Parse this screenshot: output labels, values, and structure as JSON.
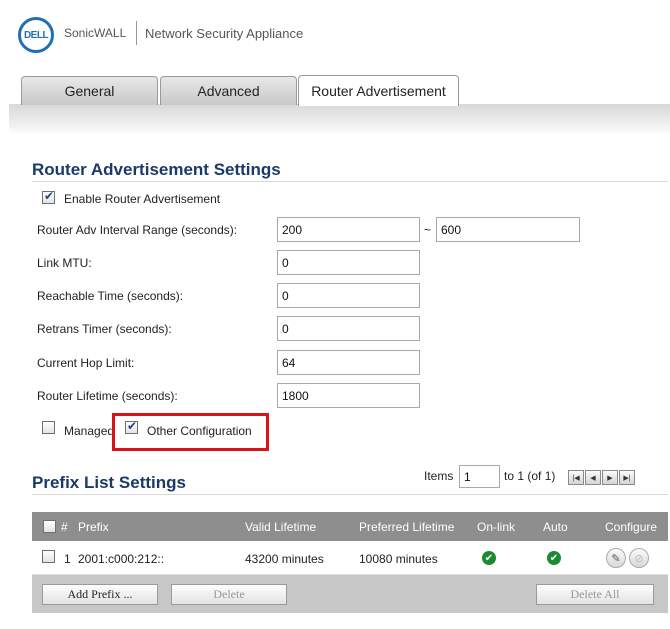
{
  "header": {
    "logo_text": "DELL",
    "brand": "SonicWALL",
    "product": "Network Security Appliance"
  },
  "tabs": [
    {
      "label": "General",
      "active": false
    },
    {
      "label": "Advanced",
      "active": false
    },
    {
      "label": "Router Advertisement",
      "active": true
    }
  ],
  "ra_settings": {
    "title": "Router Advertisement Settings",
    "enable_label": "Enable Router Advertisement",
    "enable_checked": true,
    "interval_label": "Router Adv Interval Range (seconds):",
    "interval_min": "200",
    "interval_sep": "~",
    "interval_max": "600",
    "link_mtu_label": "Link MTU:",
    "link_mtu": "0",
    "reachable_label": "Reachable Time (seconds):",
    "reachable": "0",
    "retrans_label": "Retrans Timer (seconds):",
    "retrans": "0",
    "hop_label": "Current Hop Limit:",
    "hop": "64",
    "lifetime_label": "Router Lifetime (seconds):",
    "lifetime": "1800",
    "managed_label": "Managed",
    "managed_checked": false,
    "other_config_label": "Other Configuration",
    "other_config_checked": true
  },
  "prefix": {
    "title": "Prefix List Settings",
    "items_label": "Items",
    "items_value": "1",
    "items_range": "to 1 (of 1)",
    "columns": {
      "num": "#",
      "prefix": "Prefix",
      "valid": "Valid Lifetime",
      "preferred": "Preferred Lifetime",
      "onlink": "On-link",
      "auto": "Auto",
      "configure": "Configure"
    },
    "rows": [
      {
        "num": "1",
        "prefix": "2001:c000:212::",
        "valid": "43200 minutes",
        "preferred": "10080 minutes",
        "onlink": true,
        "auto": true
      }
    ],
    "buttons": {
      "add": "Add Prefix ...",
      "delete": "Delete",
      "delete_all": "Delete All"
    }
  },
  "colors": {
    "title_blue": "#1b3a6b",
    "highlight_red": "#d8131b",
    "check_green": "#1c8a2f"
  }
}
